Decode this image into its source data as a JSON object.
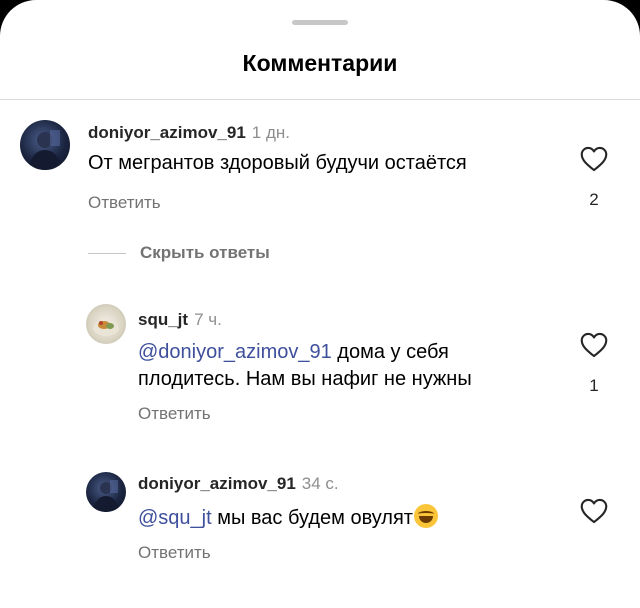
{
  "sheet": {
    "title": "Комментарии"
  },
  "comments": [
    {
      "username": "doniyor_azimov_91",
      "time": "1 дн.",
      "text": "От мегрантов здоровый будучи остаётся",
      "reply_label": "Ответить",
      "likes": "2"
    }
  ],
  "thread": {
    "hide_replies_label": "Скрыть ответы",
    "replies": [
      {
        "username": "squ_jt",
        "time": "7 ч.",
        "mention": "@doniyor_azimov_91",
        "text_line1": " дома у себя",
        "text_line2": "плодитесь. Нам вы нафиг не нужны",
        "reply_label": "Ответить",
        "likes": "1"
      },
      {
        "username": "doniyor_azimov_91",
        "time": "34 с.",
        "mention": "@squ_jt",
        "text": " мы вас будем овулят",
        "emoji": "face-with-tears-of-joy",
        "reply_label": "Ответить"
      }
    ]
  },
  "colors": {
    "mention": "#3e4f9c",
    "secondary_text": "#737373",
    "divider": "#dbdbdb"
  }
}
